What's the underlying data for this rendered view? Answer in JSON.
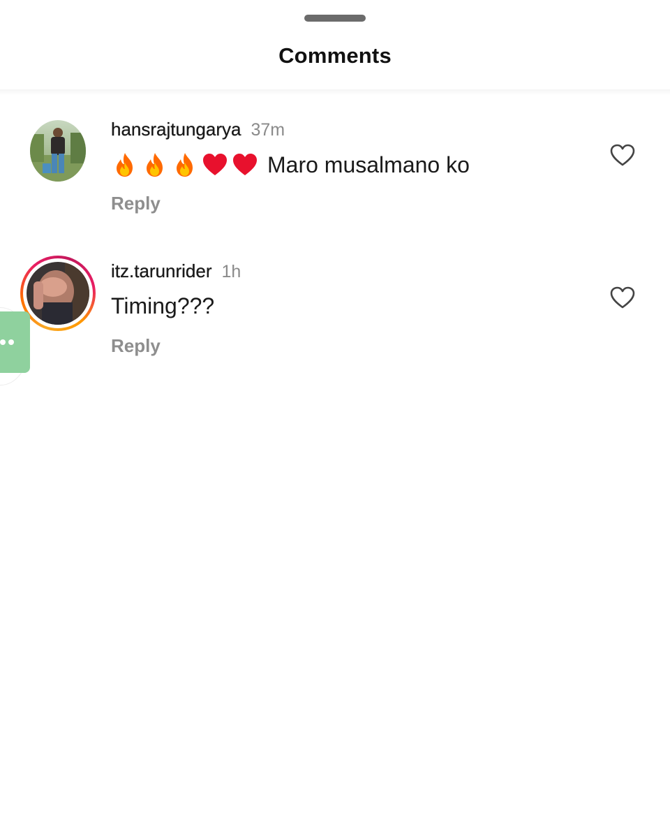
{
  "header": {
    "title": "Comments"
  },
  "comments": [
    {
      "username": "hansrajtungarya",
      "time": "37m",
      "emojis": [
        "fire",
        "fire",
        "fire",
        "red-heart",
        "red-heart"
      ],
      "text": "Maro musalmano ko",
      "reply_label": "Reply",
      "has_story_ring": false
    },
    {
      "username": "itz.tarunrider",
      "time": "1h",
      "emojis": [],
      "text": "Timing???",
      "reply_label": "Reply",
      "has_story_ring": true
    }
  ],
  "colors": {
    "story_ring_start": "#f9a825",
    "story_ring_end": "#e91e63",
    "side_widget": "#8fd19e",
    "secondary_text": "#8e8e8e"
  }
}
